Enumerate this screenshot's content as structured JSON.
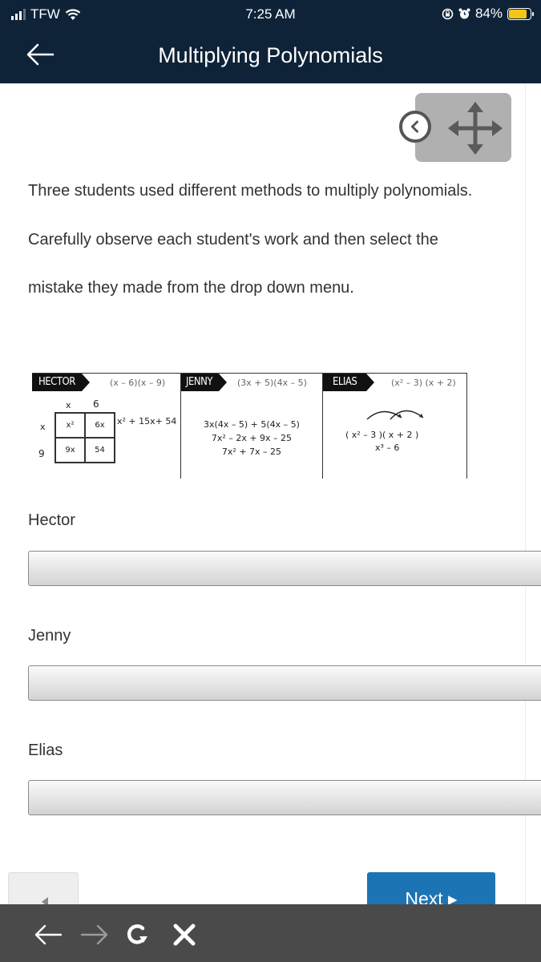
{
  "status_bar": {
    "carrier": "TFW",
    "time": "7:25 AM",
    "battery_percent": "84%",
    "battery_level": 0.84,
    "icons": [
      "signal-icon",
      "wifi-icon",
      "orientation-lock-icon",
      "alarm-icon",
      "battery-icon"
    ]
  },
  "app_bar": {
    "title": "Multiplying Polynomials",
    "back_icon": "arrow-left-icon"
  },
  "move_widget": {
    "collapse_icon": "chevron-left-circle-icon",
    "move_icon": "move-arrows-icon"
  },
  "prompt": "Three students used different methods to multiply polynomials. Carefully observe each student's work and then select the mistake they made from the drop down menu.",
  "figure": {
    "hector": {
      "name": "HECTOR",
      "problem": "(x – 6)(x – 9)",
      "col_headers": [
        "x",
        "6"
      ],
      "row_headers": [
        "x",
        "9"
      ],
      "cells": [
        "x²",
        "6x",
        "9x",
        "54"
      ],
      "result": "x² + 15x+ 54"
    },
    "jenny": {
      "name": "JENNY",
      "problem": "(3x + 5)(4x – 5)",
      "steps": [
        "3x(4x – 5) + 5(4x – 5)",
        "7x² – 2x + 9x – 25",
        "7x² + 7x – 25"
      ]
    },
    "elias": {
      "name": "ELIAS",
      "problem": "(x² – 3) (x + 2)",
      "steps": [
        "( x² – 3 )( x + 2 )",
        "x³ – 6"
      ]
    }
  },
  "questions": [
    {
      "label": "Hector",
      "selected": ""
    },
    {
      "label": "Jenny",
      "selected": ""
    },
    {
      "label": "Elias",
      "selected": ""
    }
  ],
  "nav": {
    "prev_icon": "triangle-left-icon",
    "next_label": "Next ▸"
  },
  "browser_bar": {
    "icons": [
      "back-arrow-icon",
      "forward-arrow-icon",
      "reload-icon",
      "close-icon"
    ]
  },
  "colors": {
    "header_bg": "#0f2338",
    "next_button": "#1d74b5",
    "browser_bar": "#4a4a4a",
    "battery_fill": "#f5c518"
  }
}
